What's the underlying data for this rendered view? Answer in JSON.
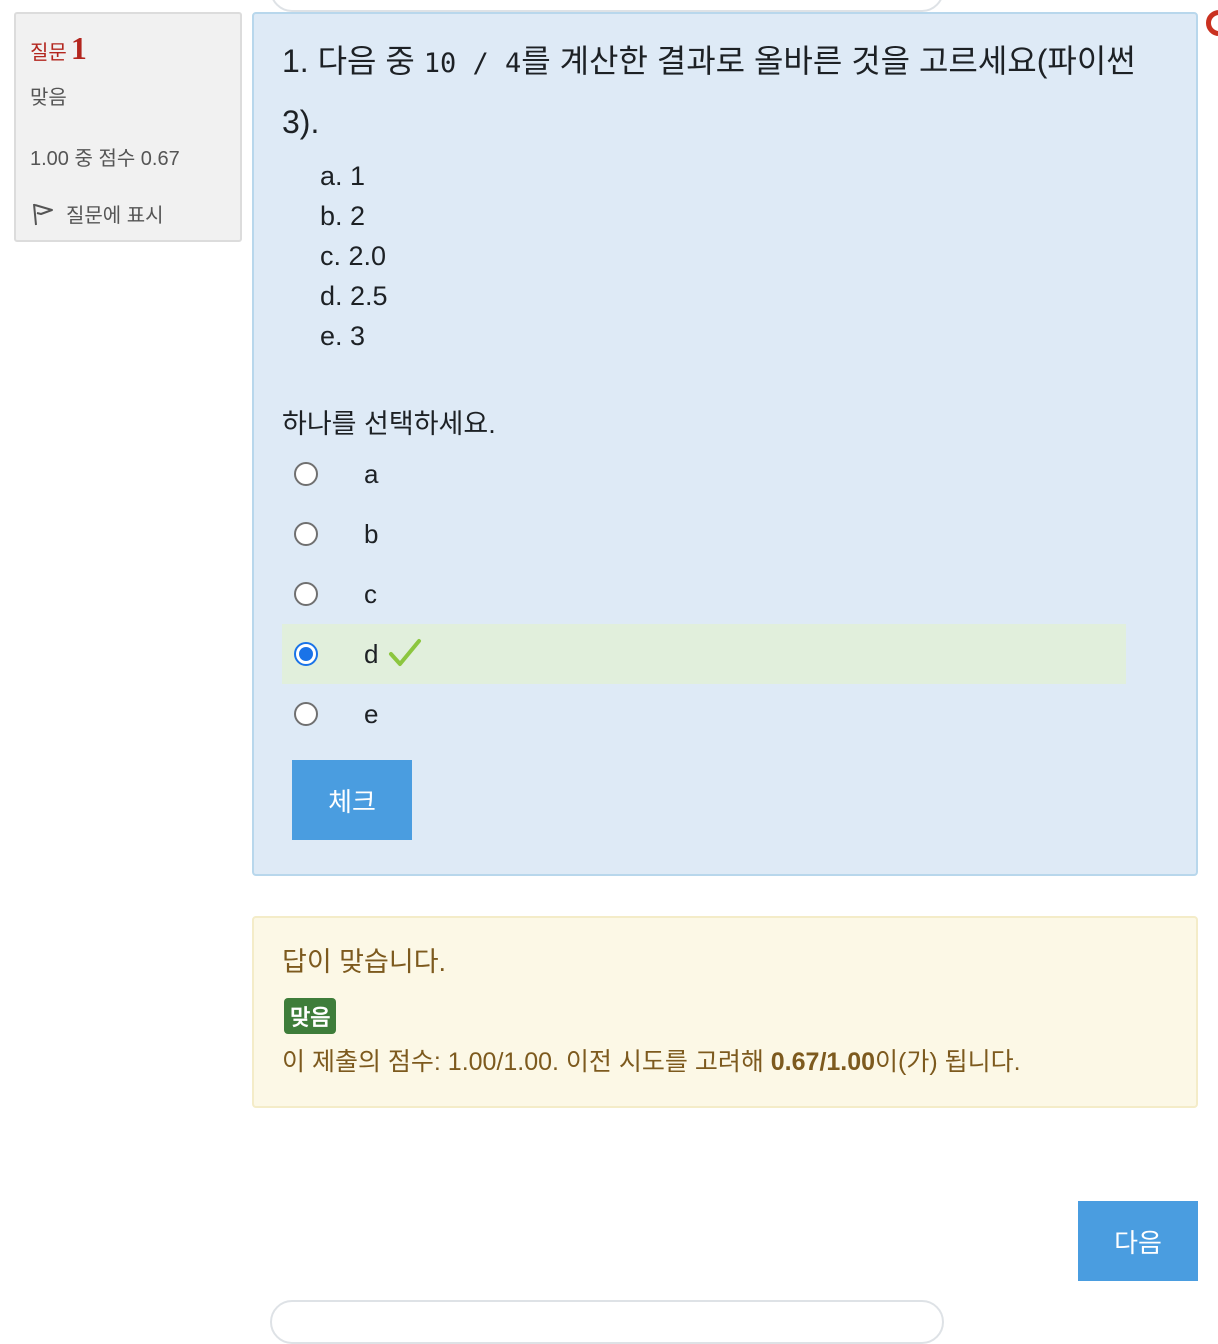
{
  "info": {
    "question_label": "질문",
    "question_number": "1",
    "state": "맞음",
    "grade": "1.00 중 점수 0.67",
    "flag_label": "질문에 표시"
  },
  "question": {
    "text_before": "1. 다음 중 ",
    "code": "10 / 4",
    "text_after": "를 계산한 결과로 올바른 것을 고르세요(파이썬 3).",
    "options": [
      "a. 1",
      "b. 2",
      "c. 2.0",
      "d. 2.5",
      "e. 3"
    ],
    "prompt": "하나를 선택하세요.",
    "answers": [
      {
        "label": "a",
        "selected": false
      },
      {
        "label": "b",
        "selected": false
      },
      {
        "label": "c",
        "selected": false
      },
      {
        "label": "d",
        "selected": true,
        "correct": true
      },
      {
        "label": "e",
        "selected": false
      }
    ],
    "check_button": "체크"
  },
  "feedback": {
    "message": "답이 맞습니다.",
    "badge": "맞음",
    "details_before": "이 제출의 점수: 1.00/1.00. 이전 시도를 고려해 ",
    "details_bold": "0.67/1.00",
    "details_after": "이(가) 됩니다."
  },
  "navigation": {
    "next_button": "다음"
  },
  "colors": {
    "accent": "#4a9de0",
    "correct_bg": "#e1efdc",
    "badge_green": "#3e7d3a",
    "question_no": "#b3261e"
  }
}
